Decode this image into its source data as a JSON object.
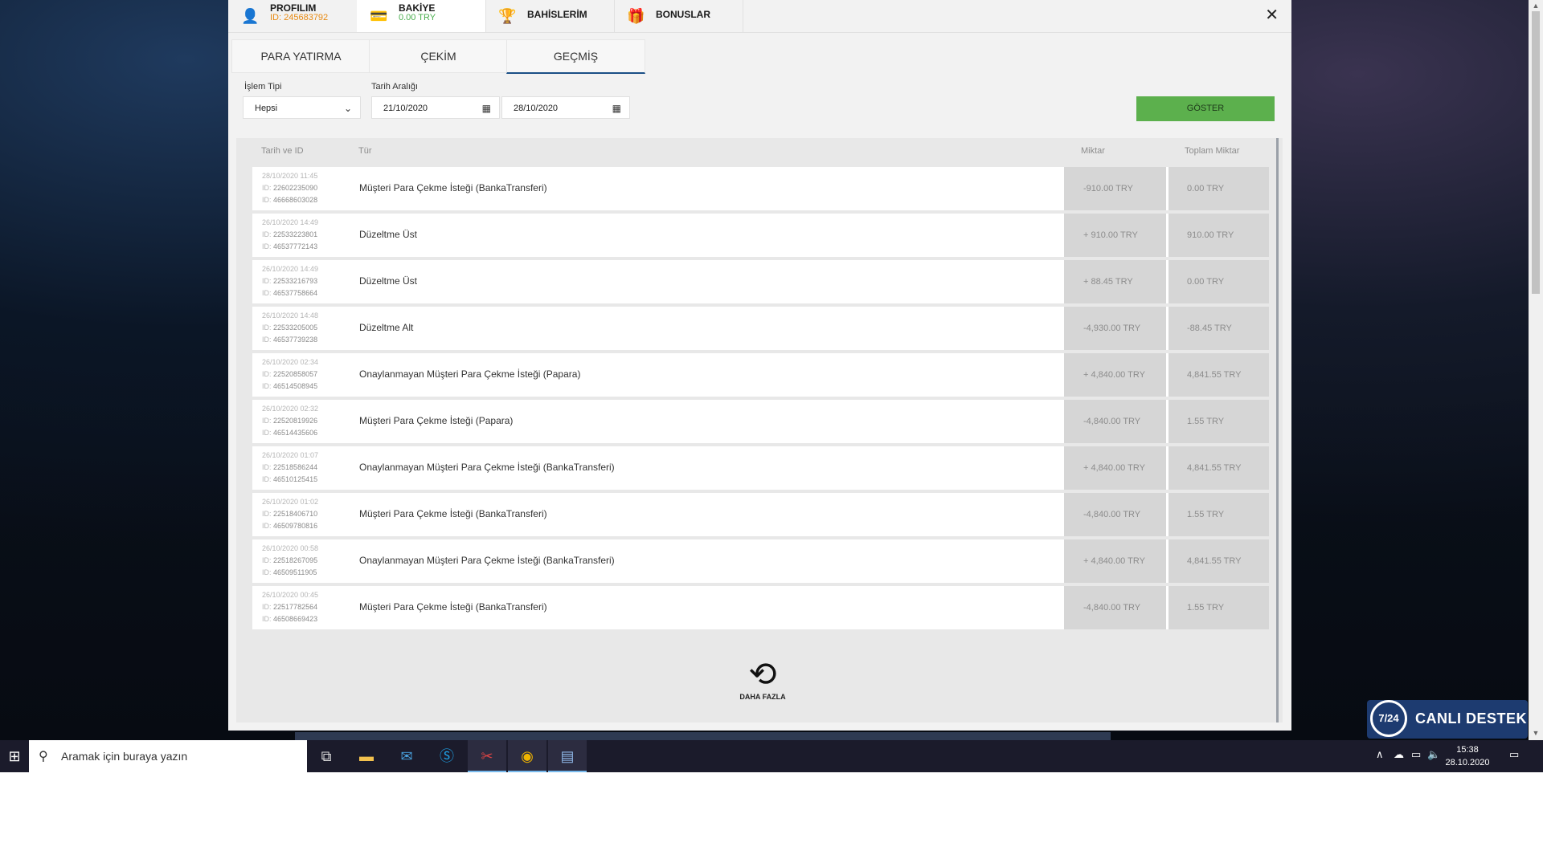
{
  "colors": {
    "accent_green": "#5cb04d",
    "active_tab_border": "#1b4f86",
    "profile_id": "#e88a12",
    "balance": "#4caf50",
    "taskbar": "#1b1b2b",
    "live_support": "#1d3b70"
  },
  "top_tabs": [
    {
      "icon": "user-icon",
      "title": "PROFILIM",
      "sub": "ID: 245683792"
    },
    {
      "icon": "wallet-icon",
      "title": "BAKİYE",
      "sub": "0.00 TRY"
    },
    {
      "icon": "trophy-icon",
      "title": "BAHİSLERİM"
    },
    {
      "icon": "gift-icon",
      "title": "BONUSLAR"
    }
  ],
  "close_icon": "close-icon",
  "sub_tabs": [
    "PARA YATIRMA",
    "ÇEKİM",
    "GEÇMİŞ"
  ],
  "active_sub_tab": "GEÇMİŞ",
  "filters": {
    "type_label": "İşlem Tipi",
    "type_value": "Hepsi",
    "date_label": "Tarih Aralığı",
    "date_from": "21/10/2020",
    "date_to": "28/10/2020",
    "show_button": "GÖSTER"
  },
  "table": {
    "headers": [
      "Tarih ve ID",
      "Tür",
      "Miktar",
      "Toplam Miktar"
    ],
    "rows": [
      {
        "date": "28/10/2020 11:45",
        "id1": "22602235090",
        "id2": "46668603028",
        "type": "Müşteri Para Çekme İsteği (BankaTransferi)",
        "amount": "-910.00 TRY",
        "total": "0.00 TRY"
      },
      {
        "date": "26/10/2020 14:49",
        "id1": "22533223801",
        "id2": "46537772143",
        "type": "Düzeltme Üst",
        "amount": "+ 910.00 TRY",
        "total": "910.00 TRY"
      },
      {
        "date": "26/10/2020 14:49",
        "id1": "22533216793",
        "id2": "46537758664",
        "type": "Düzeltme Üst",
        "amount": "+ 88.45 TRY",
        "total": "0.00 TRY"
      },
      {
        "date": "26/10/2020 14:48",
        "id1": "22533205005",
        "id2": "46537739238",
        "type": "Düzeltme Alt",
        "amount": "-4,930.00 TRY",
        "total": "-88.45 TRY"
      },
      {
        "date": "26/10/2020 02:34",
        "id1": "22520858057",
        "id2": "46514508945",
        "type": "Onaylanmayan Müşteri Para Çekme İsteği (Papara)",
        "amount": "+ 4,840.00 TRY",
        "total": "4,841.55 TRY"
      },
      {
        "date": "26/10/2020 02:32",
        "id1": "22520819926",
        "id2": "46514435606",
        "type": "Müşteri Para Çekme İsteği (Papara)",
        "amount": "-4,840.00 TRY",
        "total": "1.55 TRY"
      },
      {
        "date": "26/10/2020 01:07",
        "id1": "22518586244",
        "id2": "46510125415",
        "type": "Onaylanmayan Müşteri Para Çekme İsteği (BankaTransferi)",
        "amount": "+ 4,840.00 TRY",
        "total": "4,841.55 TRY"
      },
      {
        "date": "26/10/2020 01:02",
        "id1": "22518406710",
        "id2": "46509780816",
        "type": "Müşteri Para Çekme İsteği (BankaTransferi)",
        "amount": "-4,840.00 TRY",
        "total": "1.55 TRY"
      },
      {
        "date": "26/10/2020 00:58",
        "id1": "22518267095",
        "id2": "46509511905",
        "type": "Onaylanmayan Müşteri Para Çekme İsteği (BankaTransferi)",
        "amount": "+ 4,840.00 TRY",
        "total": "4,841.55 TRY"
      },
      {
        "date": "26/10/2020 00:45",
        "id1": "22517782564",
        "id2": "46508669423",
        "type": "Müşteri Para Çekme İsteği (BankaTransferi)",
        "amount": "-4,840.00 TRY",
        "total": "1.55 TRY"
      }
    ],
    "id_prefix": "ID:"
  },
  "more_button": {
    "icon": "refresh-icon",
    "label": "DAHA FAZLA"
  },
  "live_support": {
    "badge": "7/24",
    "label": "CANLI DESTEK",
    "icon": "headset-icon"
  },
  "taskbar": {
    "search_placeholder": "Aramak için buraya yazın",
    "apps": [
      "task-view-icon",
      "file-explorer-icon",
      "mail-icon",
      "skype-icon",
      "snipping-icon",
      "chrome-icon",
      "calculator-icon"
    ],
    "time": "15:38",
    "date": "28.10.2020"
  }
}
